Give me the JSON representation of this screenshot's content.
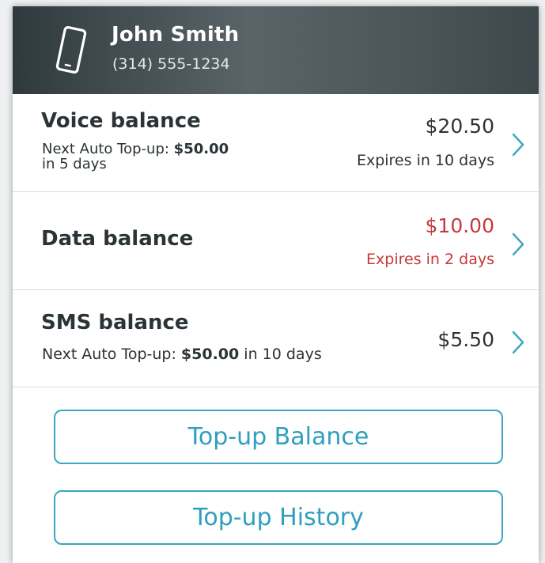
{
  "header": {
    "name": "John Smith",
    "phone": "(314) 555-1234",
    "icon": "smartphone-icon"
  },
  "balances": {
    "voice": {
      "title": "Voice balance",
      "auto_prefix": "Next  Auto Top-up: ",
      "auto_amount": "$50.00",
      "auto_suffix": "in 5 days",
      "amount": "$20.50",
      "expires": "Expires in 10 days"
    },
    "data": {
      "title": "Data balance",
      "amount": "$10.00",
      "expires": "Expires in 2 days"
    },
    "sms": {
      "title": "SMS balance",
      "auto_prefix": "Next  Auto Top-up: ",
      "auto_amount": "$50.00",
      "auto_suffix": " in 10 days",
      "amount": "$5.50"
    }
  },
  "buttons": {
    "topup_balance": "Top-up Balance",
    "topup_history": "Top-up History"
  },
  "colors": {
    "accent": "#3aa6c0",
    "warning": "#c8373a",
    "text": "#2b3336",
    "header_dark": "#2f3a3e"
  }
}
